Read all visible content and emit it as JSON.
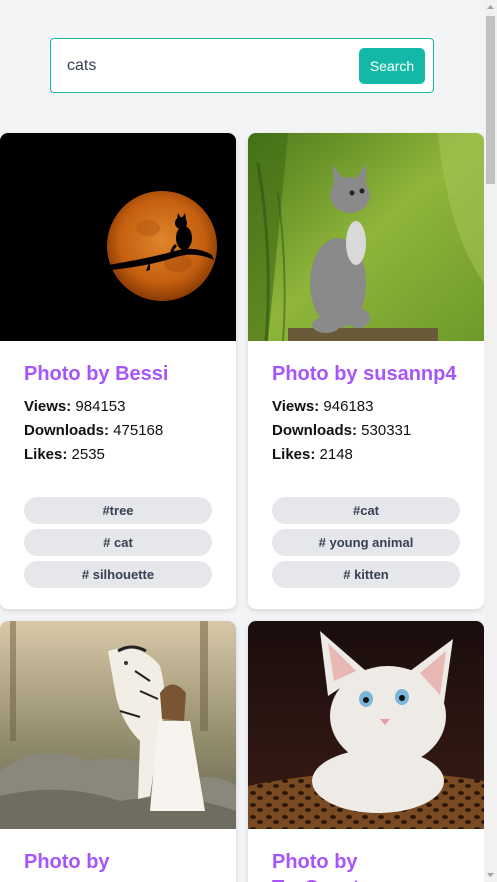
{
  "search": {
    "value": "cats",
    "button_label": "Search"
  },
  "cards": [
    {
      "title": "Photo by Bessi",
      "views_label": "Views:",
      "views": "984153",
      "downloads_label": "Downloads:",
      "downloads": "475168",
      "likes_label": "Likes:",
      "likes": "2535",
      "tags": [
        "#tree",
        "# cat",
        "# silhouette"
      ],
      "image": "cat-silhouette-on-branch-full-moon"
    },
    {
      "title": "Photo by susannp4",
      "views_label": "Views:",
      "views": "946183",
      "downloads_label": "Downloads:",
      "downloads": "530331",
      "likes_label": "Likes:",
      "likes": "2148",
      "tags": [
        "#cat",
        "# young animal",
        "# kitten"
      ],
      "image": "grey-kitten-in-grass"
    },
    {
      "title": "Photo by",
      "image": "white-tiger-and-woman-on-rocks"
    },
    {
      "title": "Photo by Ty_Swartz",
      "image": "white-kitten-on-leopard-cushion"
    }
  ],
  "colors": {
    "accent": "#14b8a6",
    "title": "#a855f7",
    "tag_bg": "#e5e7eb"
  }
}
